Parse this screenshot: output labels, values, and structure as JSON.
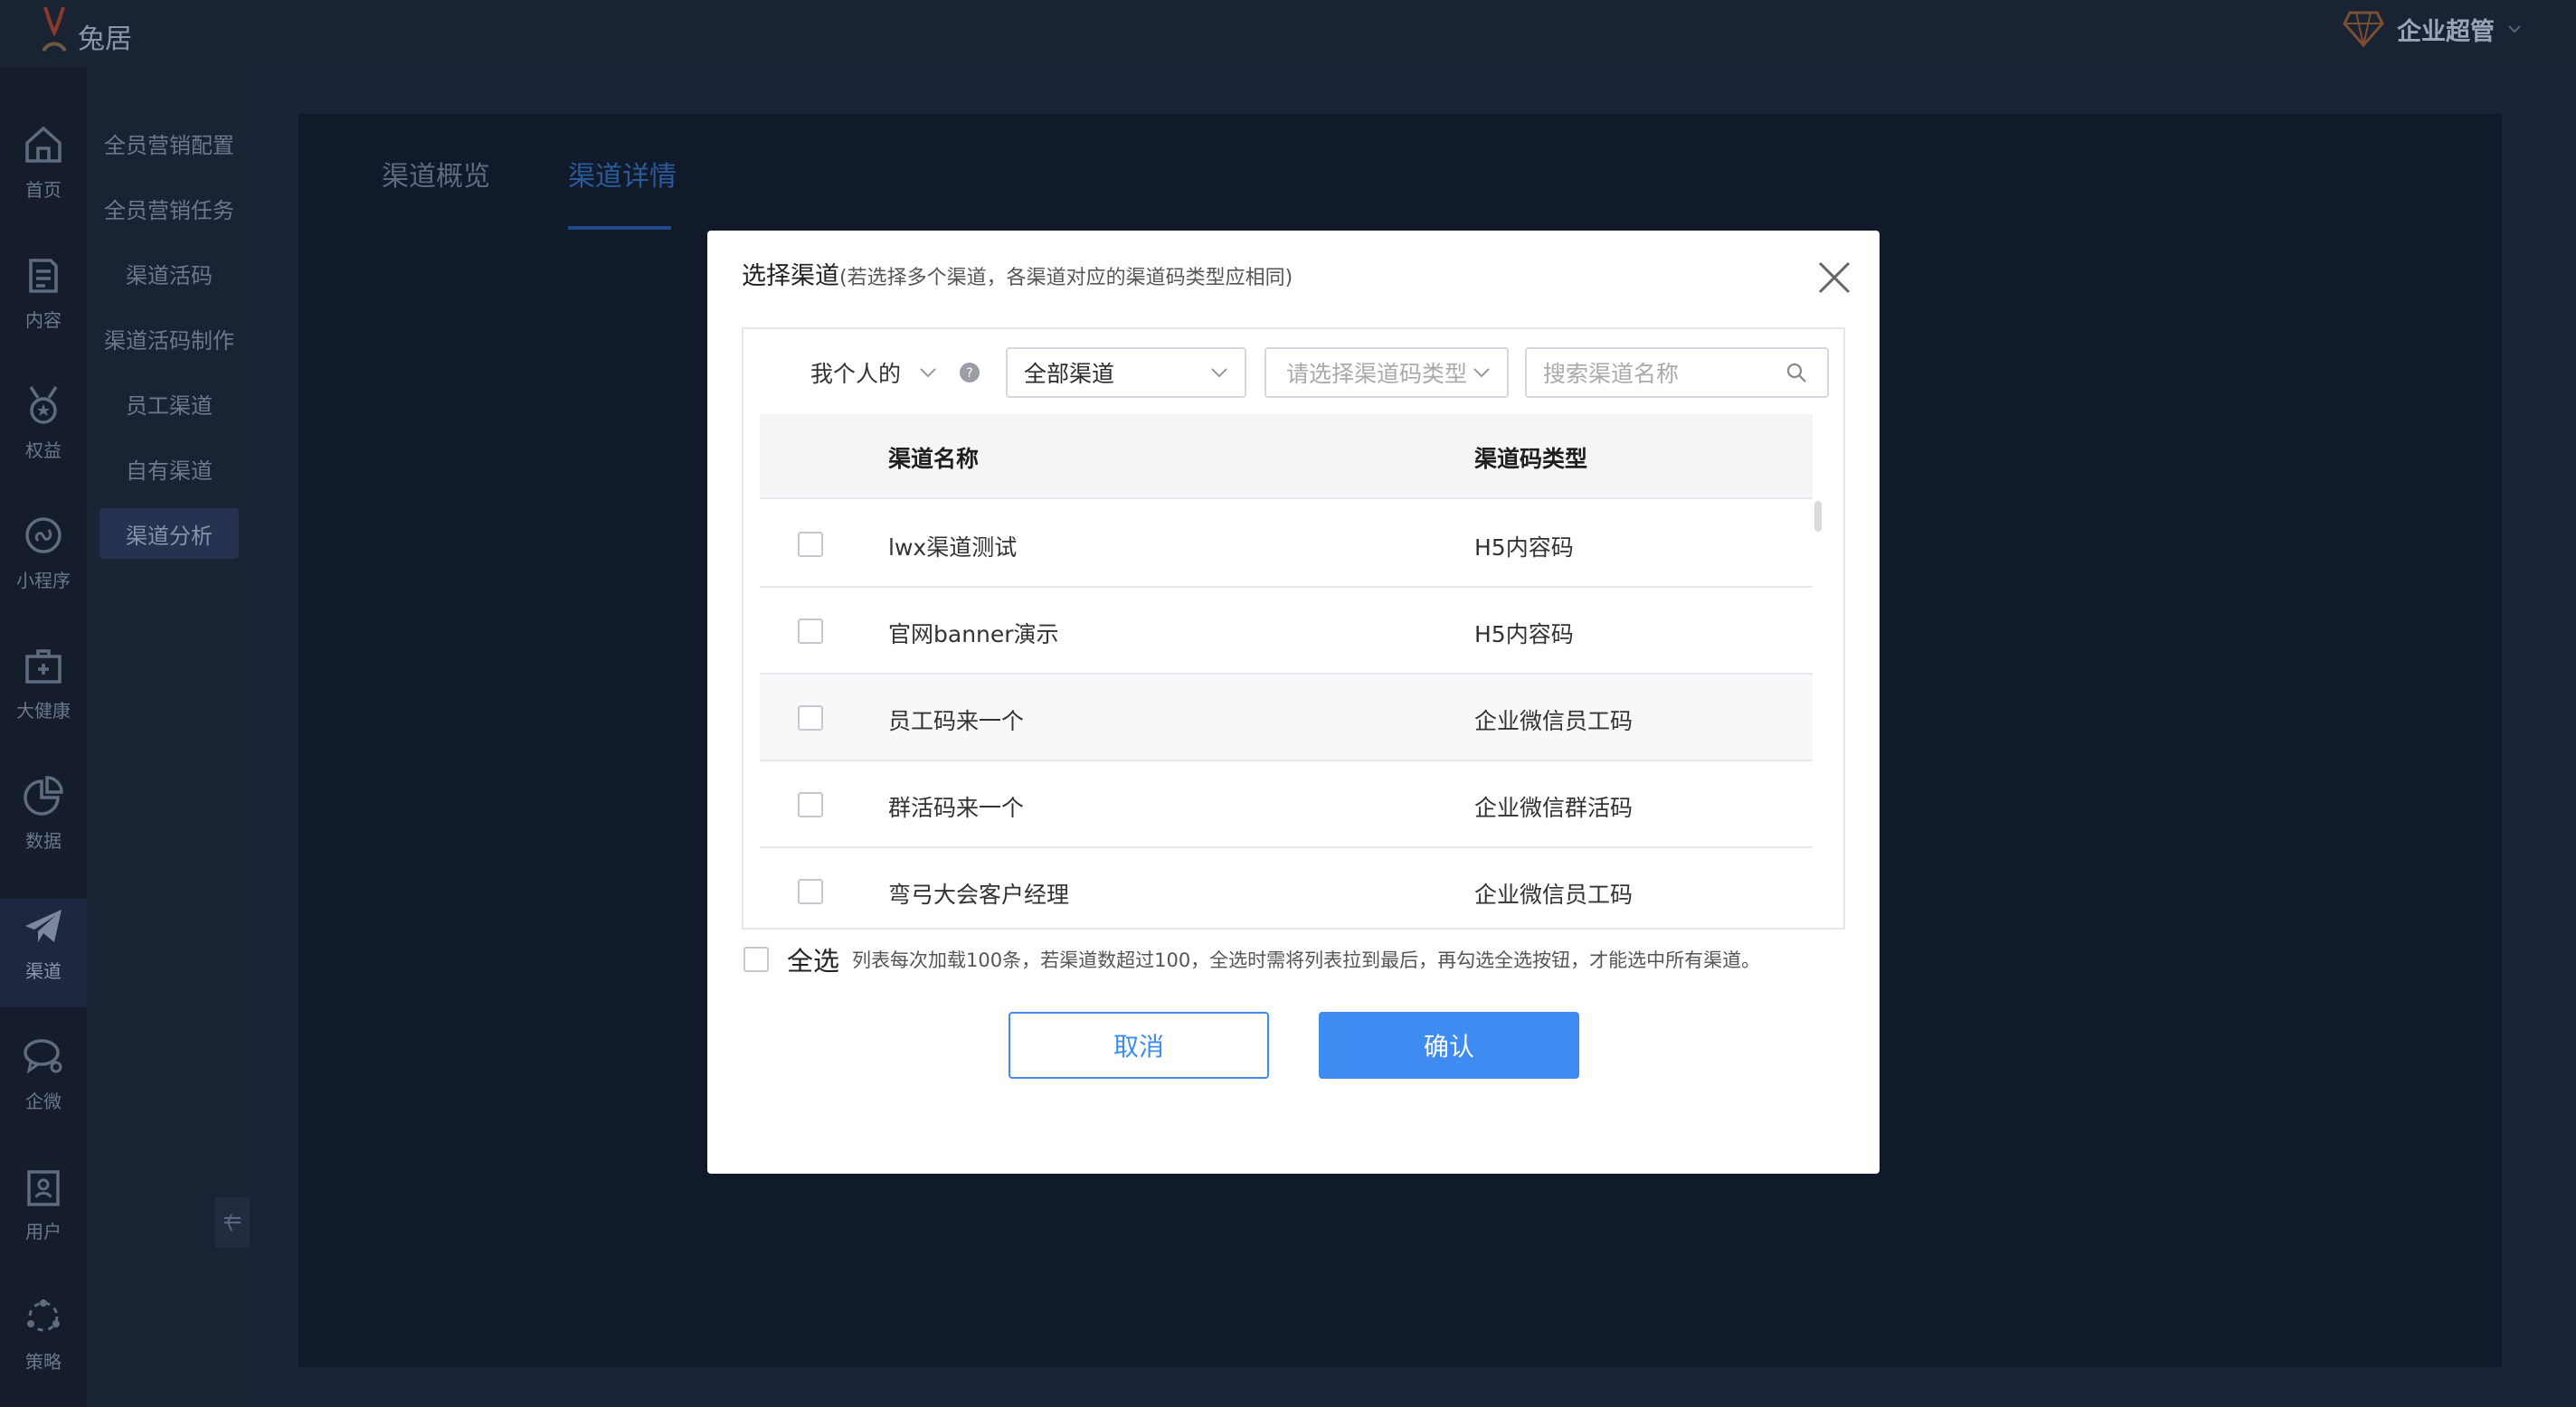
{
  "header": {
    "logo_text": "兔居",
    "role": "企业超管"
  },
  "rail": [
    {
      "label": "首页",
      "icon": "home-icon"
    },
    {
      "label": "内容",
      "icon": "document-icon"
    },
    {
      "label": "权益",
      "icon": "medal-icon"
    },
    {
      "label": "小程序",
      "icon": "mini-program-icon"
    },
    {
      "label": "大健康",
      "icon": "medical-kit-icon"
    },
    {
      "label": "数据",
      "icon": "pie-chart-icon"
    },
    {
      "label": "渠道",
      "icon": "paper-plane-icon"
    },
    {
      "label": "企微",
      "icon": "chat-icon"
    },
    {
      "label": "用户",
      "icon": "user-card-icon"
    },
    {
      "label": "策略",
      "icon": "strategy-icon"
    }
  ],
  "submenu": [
    {
      "label": "全员营销配置"
    },
    {
      "label": "全员营销任务"
    },
    {
      "label": "渠道活码"
    },
    {
      "label": "渠道活码制作"
    },
    {
      "label": "员工渠道"
    },
    {
      "label": "自有渠道"
    },
    {
      "label": "渠道分析"
    }
  ],
  "tabs": [
    {
      "label": "渠道概览"
    },
    {
      "label": "渠道详情"
    }
  ],
  "modal": {
    "title": "选择渠道",
    "subtitle": "(若选择多个渠道，各渠道对应的渠道码类型应相同)",
    "owner_filter": "我个人的",
    "channel_filter": "全部渠道",
    "type_filter_placeholder": "请选择渠道码类型",
    "search_placeholder": "搜索渠道名称",
    "columns": {
      "name": "渠道名称",
      "type": "渠道码类型"
    },
    "rows": [
      {
        "name": "lwx渠道测试",
        "type": "H5内容码"
      },
      {
        "name": "官网banner演示",
        "type": "H5内容码"
      },
      {
        "name": "员工码来一个",
        "type": "企业微信员工码"
      },
      {
        "name": "群活码来一个",
        "type": "企业微信群活码"
      },
      {
        "name": "弯弓大会客户经理",
        "type": "企业微信员工码"
      }
    ],
    "select_all_label": "全选",
    "select_all_hint": "列表每次加载100条，若渠道数超过100，全选时需将列表拉到最后，再勾选全选按钮，才能选中所有渠道。",
    "cancel_label": "取消",
    "confirm_label": "确认"
  },
  "colors": {
    "primary": "#3e8bf2",
    "backdrop": "#111a2a"
  }
}
